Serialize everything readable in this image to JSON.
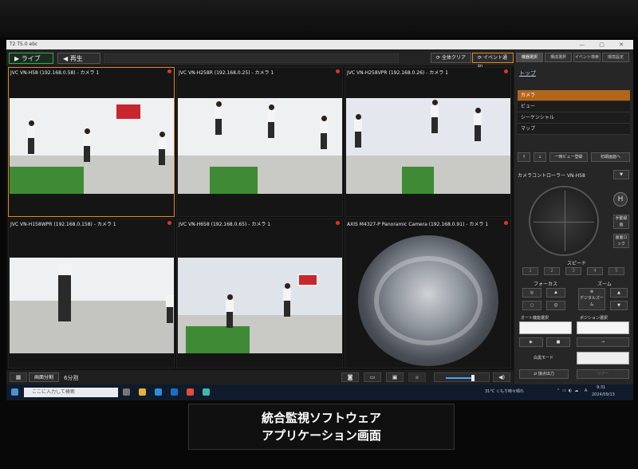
{
  "window": {
    "title": "T2 T5.0 ebc",
    "controls": "— ▢ ✕"
  },
  "toolbar": {
    "live_label": "ライブ",
    "playback_label": "再生",
    "clear_all_label": "全体クリア",
    "event_label": "イベント通知"
  },
  "cameras": [
    {
      "label": "JVC VN-H58 (192.168.0.58) - カメラ 1",
      "selected": true
    },
    {
      "label": "JVC VN-H258R (192.168.0.25) - カメラ 1",
      "selected": false
    },
    {
      "label": "JVC VN-H258VPR (192.168.0.26) - カメラ 1",
      "selected": false
    },
    {
      "label": "JVC VN-H158WPR (192.168.0.158) - カメラ 1",
      "selected": false
    },
    {
      "label": "JVC VN-H658 (192.168.0.65) - カメラ 1",
      "selected": false
    },
    {
      "label": "AXIS M4327-P Panoramic Camera (192.168.0.91) - カメラ 1",
      "selected": false
    }
  ],
  "bottombar": {
    "split_label": "6分割",
    "layout_label": "画面分割"
  },
  "panel": {
    "tabs": [
      "機器選択",
      "構成選択",
      "イベント検索",
      "環境設定"
    ],
    "top_link": "トップ",
    "menu": [
      {
        "label": "カメラ",
        "active": true
      },
      {
        "label": "ビュー",
        "active": false
      },
      {
        "label": "シーケンシャル",
        "active": false
      },
      {
        "label": "マップ",
        "active": false
      }
    ],
    "view_save_label": "一時ビュー登録",
    "initial_view_label": "初期画面へ",
    "controller_label": "カメラコントローラー",
    "controller_model": "VN-H58",
    "h_label": "H",
    "record_label": "手動録画",
    "lock_label": "画面ロック",
    "speed_label": "スピード",
    "speed_levels": [
      "1",
      "2",
      "3",
      "4",
      "5"
    ],
    "focus_label": "フォーカス",
    "zoom_label": "ズーム",
    "digital_zoom_label": "デジタルズーム",
    "auto_tracking_label": "オート機能選択",
    "position_label": "ポジション選択",
    "alarm_mode_label": "白黒モード",
    "alarm_out_label": "接点出力",
    "tour_label": "ツアー"
  },
  "taskbar": {
    "search_placeholder": "ここに入力して検索",
    "weather": "31°C くもり時々晴れ",
    "time": "9:31",
    "date": "2024/09/13"
  },
  "caption": {
    "line1": "統合監視ソフトウェア",
    "line2": "アプリケーション画面"
  }
}
